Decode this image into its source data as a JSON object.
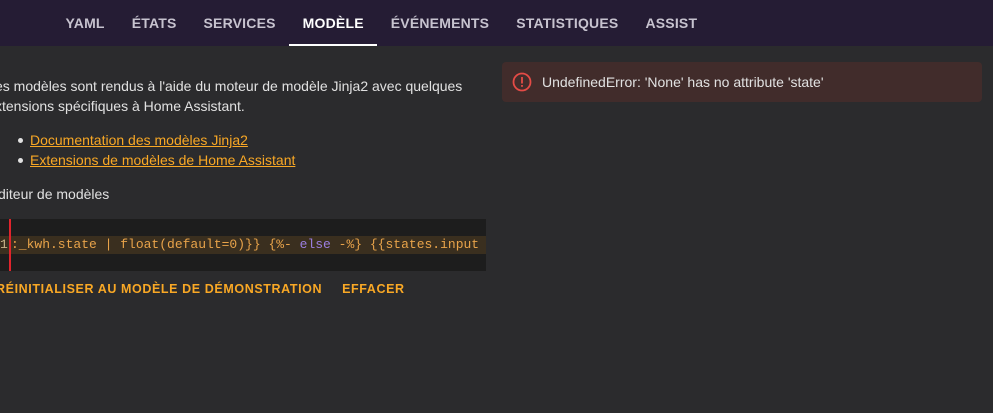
{
  "tabs": [
    {
      "label": "YAML"
    },
    {
      "label": "ÉTATS"
    },
    {
      "label": "SERVICES"
    },
    {
      "label": "MODÈLE"
    },
    {
      "label": "ÉVÉNEMENTS"
    },
    {
      "label": "STATISTIQUES"
    },
    {
      "label": "ASSIST"
    }
  ],
  "active_tab": "MODÈLE",
  "intro": {
    "line1": "es modèles sont rendus à l'aide du moteur de modèle Jinja2 avec quelques",
    "line2": "xtensions spécifiques à Home Assistant."
  },
  "links": [
    {
      "label": "Documentation des modèles Jinja2"
    },
    {
      "label": "Extensions de modèles de Home Assistant"
    }
  ],
  "editor": {
    "label": "diteur de modèles",
    "line_number": "1",
    "code_part1": ":_kwh.state | float(default=0)}} {%- ",
    "code_keyword": "else",
    "code_part2": " -%} {{states.input"
  },
  "actions": {
    "reset": "RÉINITIALISER AU MODÈLE DE DÉMONSTRATION",
    "clear": "EFFACER"
  },
  "error": {
    "icon": "alert-circle-icon",
    "message": "UndefinedError: 'None' has no attribute 'state'"
  },
  "colors": {
    "accent": "#f9a825",
    "header": "#251c34",
    "error": "#e44b46"
  }
}
